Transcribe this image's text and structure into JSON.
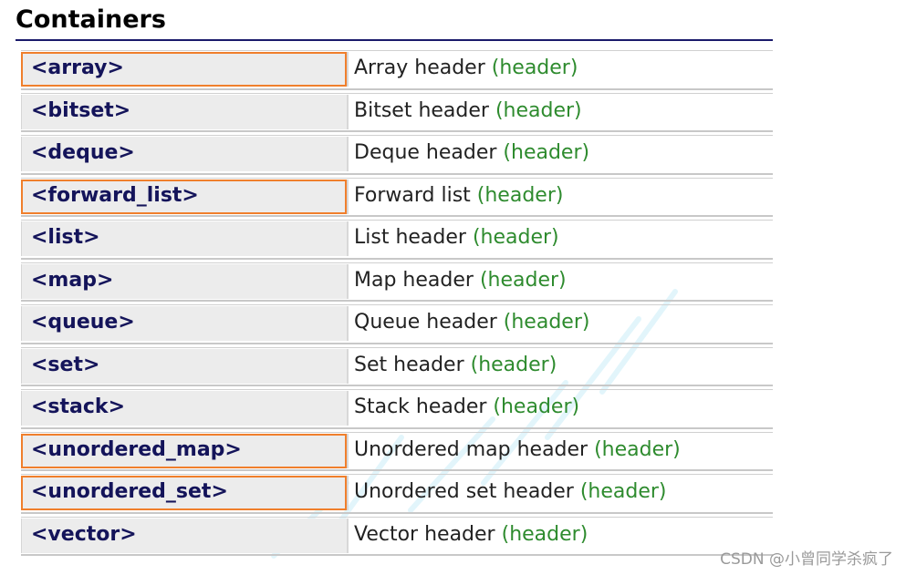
{
  "section": {
    "title": "Containers"
  },
  "rows": [
    {
      "name": "<array>",
      "desc": "Array header",
      "tag": "(header)",
      "highlight": true
    },
    {
      "name": "<bitset>",
      "desc": "Bitset header",
      "tag": "(header)",
      "highlight": false
    },
    {
      "name": "<deque>",
      "desc": "Deque header",
      "tag": "(header)",
      "highlight": false
    },
    {
      "name": "<forward_list>",
      "desc": "Forward list",
      "tag": "(header)",
      "highlight": true
    },
    {
      "name": "<list>",
      "desc": "List header",
      "tag": "(header)",
      "highlight": false
    },
    {
      "name": "<map>",
      "desc": "Map header",
      "tag": "(header)",
      "highlight": false
    },
    {
      "name": "<queue>",
      "desc": "Queue header",
      "tag": "(header)",
      "highlight": false
    },
    {
      "name": "<set>",
      "desc": "Set header",
      "tag": "(header)",
      "highlight": false
    },
    {
      "name": "<stack>",
      "desc": "Stack header",
      "tag": "(header)",
      "highlight": false
    },
    {
      "name": "<unordered_map>",
      "desc": "Unordered map header",
      "tag": "(header)",
      "highlight": true
    },
    {
      "name": "<unordered_set>",
      "desc": "Unordered set header",
      "tag": "(header)",
      "highlight": true
    },
    {
      "name": "<vector>",
      "desc": "Vector header",
      "tag": "(header)",
      "highlight": false
    }
  ],
  "watermark": {
    "text": "CSDN @小曾同学杀疯了"
  },
  "colors": {
    "link": "#14145a",
    "tag": "#2e8b2e",
    "highlight_border": "#f07f2c",
    "title_rule": "#1a1a6b"
  }
}
